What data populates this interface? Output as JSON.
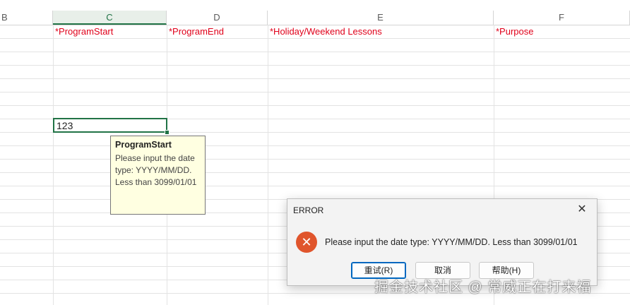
{
  "columns": [
    "B",
    "C",
    "D",
    "E",
    "F"
  ],
  "header_cells": {
    "c": "*ProgramStart",
    "d": "*ProgramEnd",
    "e": "*Holiday/Weekend Lessons",
    "f": "*Purpose"
  },
  "active_cell": {
    "value": "123"
  },
  "tooltip": {
    "title": "ProgramStart",
    "line1": "Please input the date",
    "line2": "type: YYYY/MM/DD.",
    "line3": "Less than 3099/01/01"
  },
  "dialog": {
    "title": "ERROR",
    "close_glyph": "✕",
    "message": "Please input the date type: YYYY/MM/DD. Less than 3099/01/01",
    "buttons": {
      "retry": "重试(R)",
      "cancel": "取消",
      "help": "帮助(H)"
    },
    "icon": "error-x-icon",
    "icon_glyph": "✕"
  },
  "watermark": "掘金技术社区 @ 常威正在打来福",
  "colors": {
    "accent": "#217346",
    "required_text": "#e0001a",
    "error_icon": "#e0552c"
  }
}
